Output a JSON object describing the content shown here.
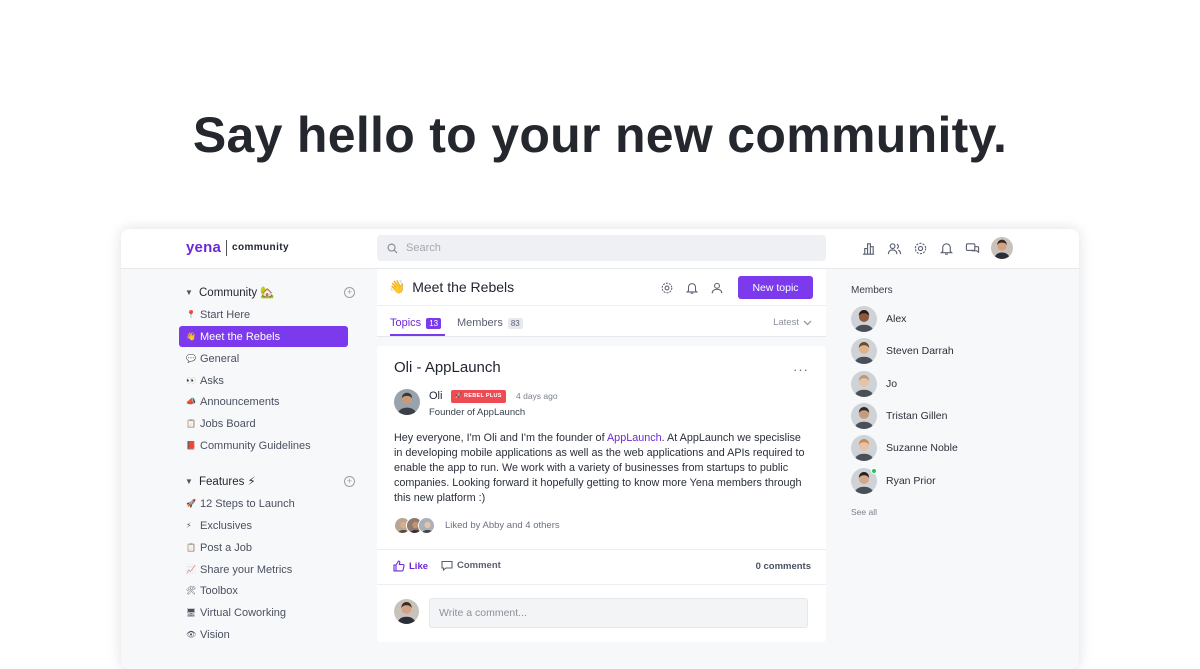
{
  "hero": {
    "title": "Say hello to your new community."
  },
  "topbar": {
    "logo_name": "yena",
    "logo_sub": "community",
    "search_placeholder": "Search",
    "icons": [
      "leaderboard-icon",
      "people-icon",
      "settings-icon",
      "notifications-icon",
      "messages-icon"
    ]
  },
  "sidebar": {
    "sections": [
      {
        "label": "Community 🏡",
        "items": [
          {
            "emoji": "📍",
            "label": "Start Here"
          },
          {
            "emoji": "👋",
            "label": "Meet the Rebels",
            "active": true
          },
          {
            "emoji": "💬",
            "label": "General"
          },
          {
            "emoji": "👀",
            "label": "Asks"
          },
          {
            "emoji": "📣",
            "label": "Announcements"
          },
          {
            "emoji": "📋",
            "label": "Jobs Board"
          },
          {
            "emoji": "📕",
            "label": "Community Guidelines"
          }
        ]
      },
      {
        "label": "Features ⚡",
        "items": [
          {
            "emoji": "🚀",
            "label": "12 Steps to Launch"
          },
          {
            "emoji": "⚡",
            "label": "Exclusives"
          },
          {
            "emoji": "📋",
            "label": "Post a Job"
          },
          {
            "emoji": "📈",
            "label": "Share your Metrics"
          },
          {
            "emoji": "🛠",
            "label": "Toolbox"
          },
          {
            "emoji": "🖥",
            "label": "Virtual Coworking"
          },
          {
            "emoji": "👁",
            "label": "Vision"
          }
        ]
      }
    ]
  },
  "channel": {
    "emoji": "👋",
    "title": "Meet the Rebels",
    "new_topic": "New topic",
    "tabs": [
      {
        "label": "Topics",
        "count": "13"
      },
      {
        "label": "Members",
        "count": "83"
      }
    ],
    "sort_label": "Latest"
  },
  "post": {
    "title": "Oli - AppLaunch",
    "more": "···",
    "author": "Oli",
    "badge": "🚀 REBEL PLUS",
    "time": "4 days ago",
    "role": "Founder of AppLaunch",
    "body_pre": "Hey everyone, I'm Oli and I'm the founder of ",
    "body_link": "AppLaunch",
    "body_post": ". At AppLaunch we specislise in developing mobile applications as well as the web applications and APIs required to enable the app to run. We work with a variety of businesses from startups to public companies. Looking forward it hopefully getting to know more Yena members through this new platform :)",
    "liked_by": "Liked by Abby and 4 others",
    "like_label": "Like",
    "comment_label": "Comment",
    "comment_count": "0 comments",
    "comment_placeholder": "Write a comment..."
  },
  "members_panel": {
    "title": "Members",
    "members": [
      {
        "name": "Alex",
        "skin": "#8a5a3c",
        "hair": "#2a1a10"
      },
      {
        "name": "Steven Darrah",
        "skin": "#e0b48a",
        "hair": "#6b4a2a"
      },
      {
        "name": "Jo",
        "skin": "#e6c3a4",
        "hair": "#b89a74"
      },
      {
        "name": "Tristan Gillen",
        "skin": "#c99a7a",
        "hair": "#2b2b2b"
      },
      {
        "name": "Suzanne Noble",
        "skin": "#e8c2a8",
        "hair": "#c98a50"
      },
      {
        "name": "Ryan Prior",
        "skin": "#d6a888",
        "hair": "#222222",
        "online": true
      }
    ],
    "see_all": "See all"
  },
  "colors": {
    "accent": "#7c3aed",
    "badge": "#ef4b55",
    "online": "#22c55e"
  }
}
